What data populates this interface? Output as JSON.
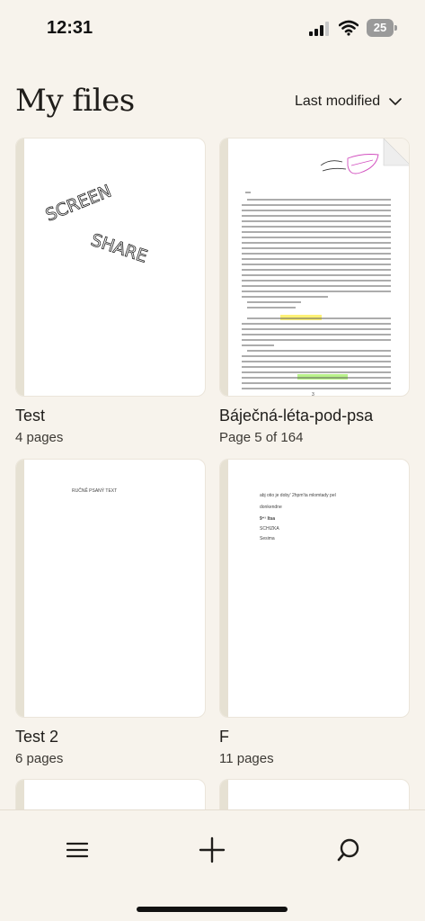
{
  "status_bar": {
    "time": "12:31",
    "battery": "25"
  },
  "header": {
    "title": "My files",
    "sort_label": "Last modified"
  },
  "files": [
    {
      "name": "Test",
      "meta": "4 pages",
      "thumb_text": [
        "SCREEN",
        "SHARE"
      ]
    },
    {
      "name": "Báječná-léta-pod-psa",
      "meta": "Page 5 of 164",
      "thumb_text": [
        "3"
      ]
    },
    {
      "name": "Test 2",
      "meta": "6 pages",
      "thumb_text": [
        "RUČNĚ PSANÝ TEXT"
      ]
    },
    {
      "name": "F",
      "meta": "11 pages",
      "thumb_text": [
        "abj otio je doby' 2hpm'ta mlomtady pel",
        "donkendne",
        "9⁺¹ ltsa",
        "SCHIZKA",
        "Sesima"
      ]
    }
  ],
  "colors": {
    "background": "#f7f3ec",
    "spine": "#e6e1d3",
    "highlight_yellow": "#fff176",
    "highlight_green": "#b9f28a",
    "handwriting_pink": "#d24fbf"
  },
  "icons": {
    "menu": "hamburger-icon",
    "add": "plus-icon",
    "search": "search-icon"
  }
}
